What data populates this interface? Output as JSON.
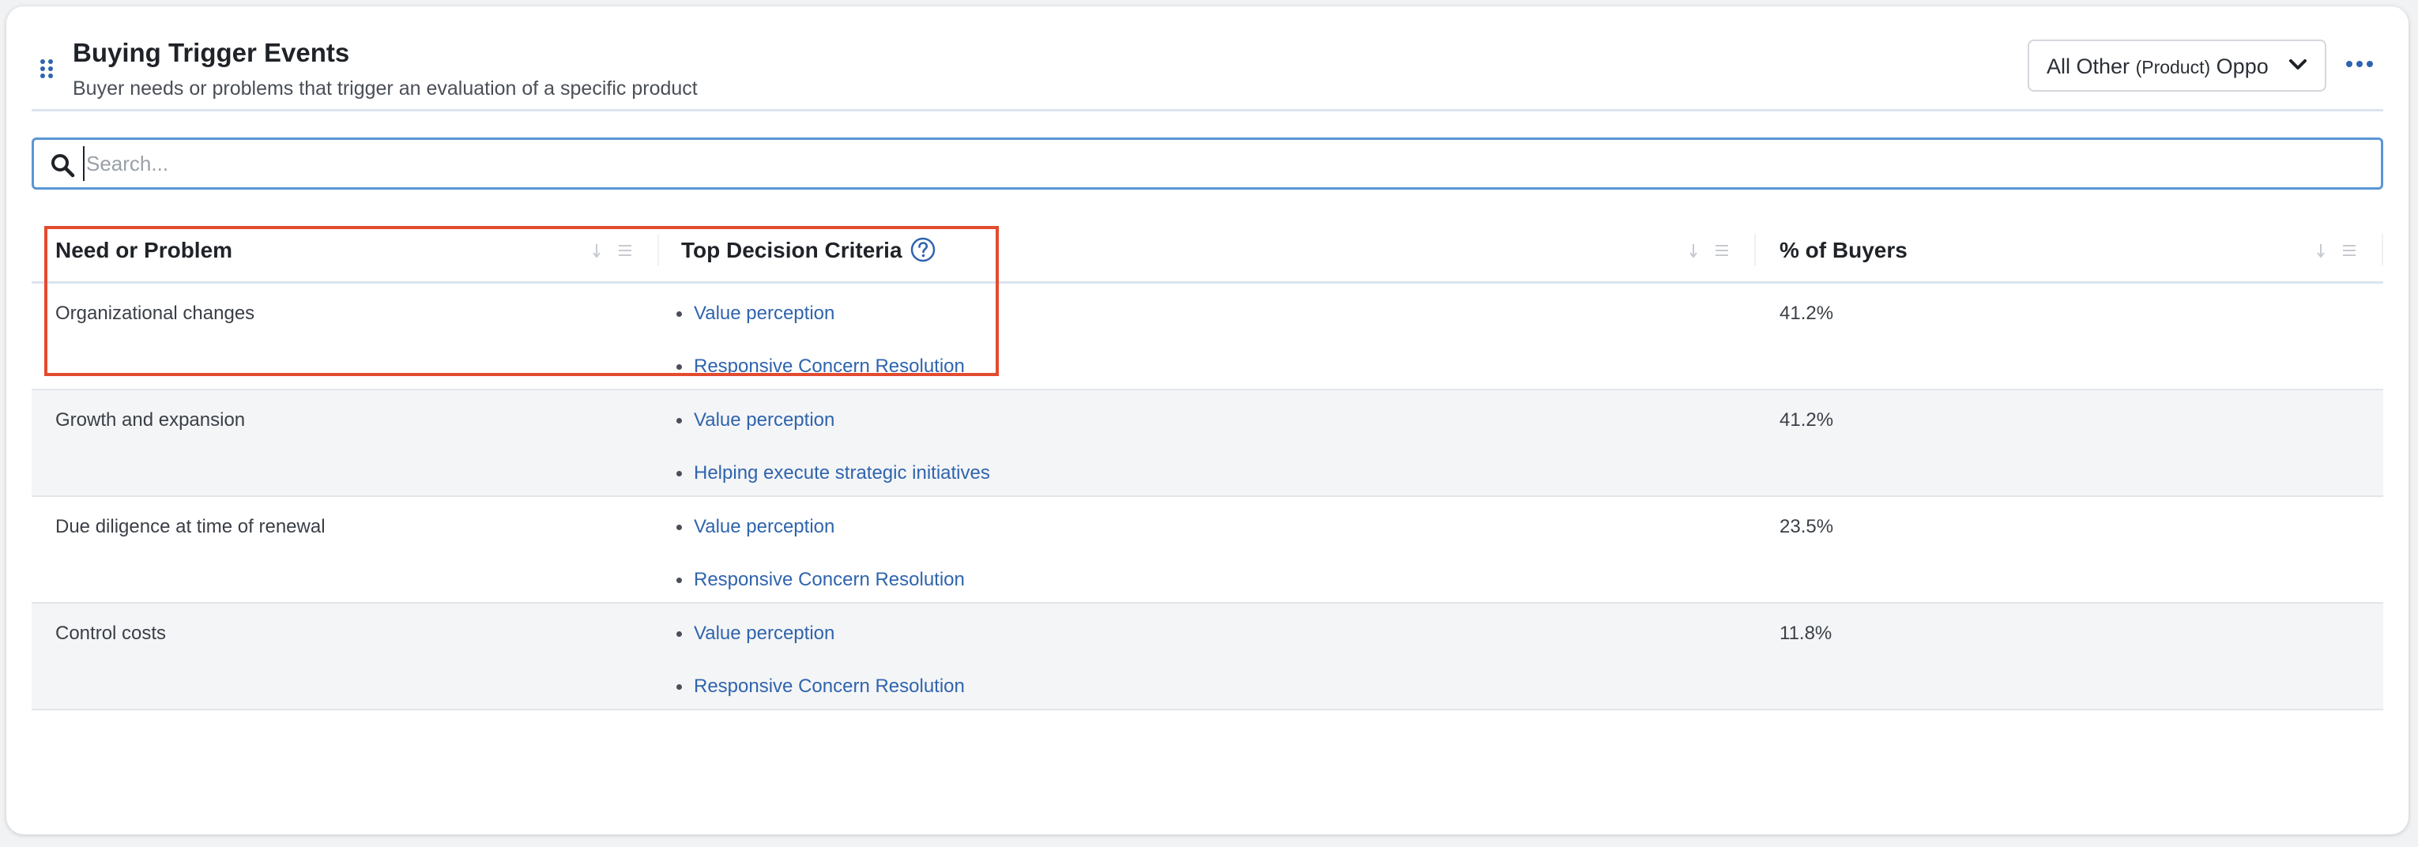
{
  "widget": {
    "title": "Buying Trigger Events",
    "subtitle": "Buyer needs or problems that trigger an evaluation of a specific product",
    "filter": {
      "label_prefix": "All Other",
      "label_small": "(Product)",
      "label_suffix": "Opportunities"
    }
  },
  "search": {
    "placeholder": "Search..."
  },
  "table": {
    "columns": [
      {
        "label": "Need or Problem"
      },
      {
        "label": "Top Decision Criteria"
      },
      {
        "label": "% of Buyers"
      }
    ],
    "rows": [
      {
        "need": "Organizational changes",
        "criteria": [
          "Value perception",
          "Responsive Concern Resolution"
        ],
        "pct": "41.2%"
      },
      {
        "need": "Growth and expansion",
        "criteria": [
          "Value perception",
          "Helping execute strategic initiatives"
        ],
        "pct": "41.2%"
      },
      {
        "need": "Due diligence at time of renewal",
        "criteria": [
          "Value perception",
          "Responsive Concern Resolution"
        ],
        "pct": "23.5%"
      },
      {
        "need": "Control costs",
        "criteria": [
          "Value perception",
          "Responsive Concern Resolution"
        ],
        "pct": "11.8%"
      }
    ]
  },
  "colors": {
    "link": "#2f64ad",
    "accent": "#2f64ad",
    "highlight": "#e34b2e",
    "search_border": "#5b95d6"
  },
  "icons": {
    "drag": "drag-handle-icon",
    "chevron": "chevron-down-icon",
    "more": "more-icon",
    "search": "search-icon",
    "help": "help-icon",
    "sort": "sort-icon",
    "column_menu": "column-menu-icon"
  }
}
